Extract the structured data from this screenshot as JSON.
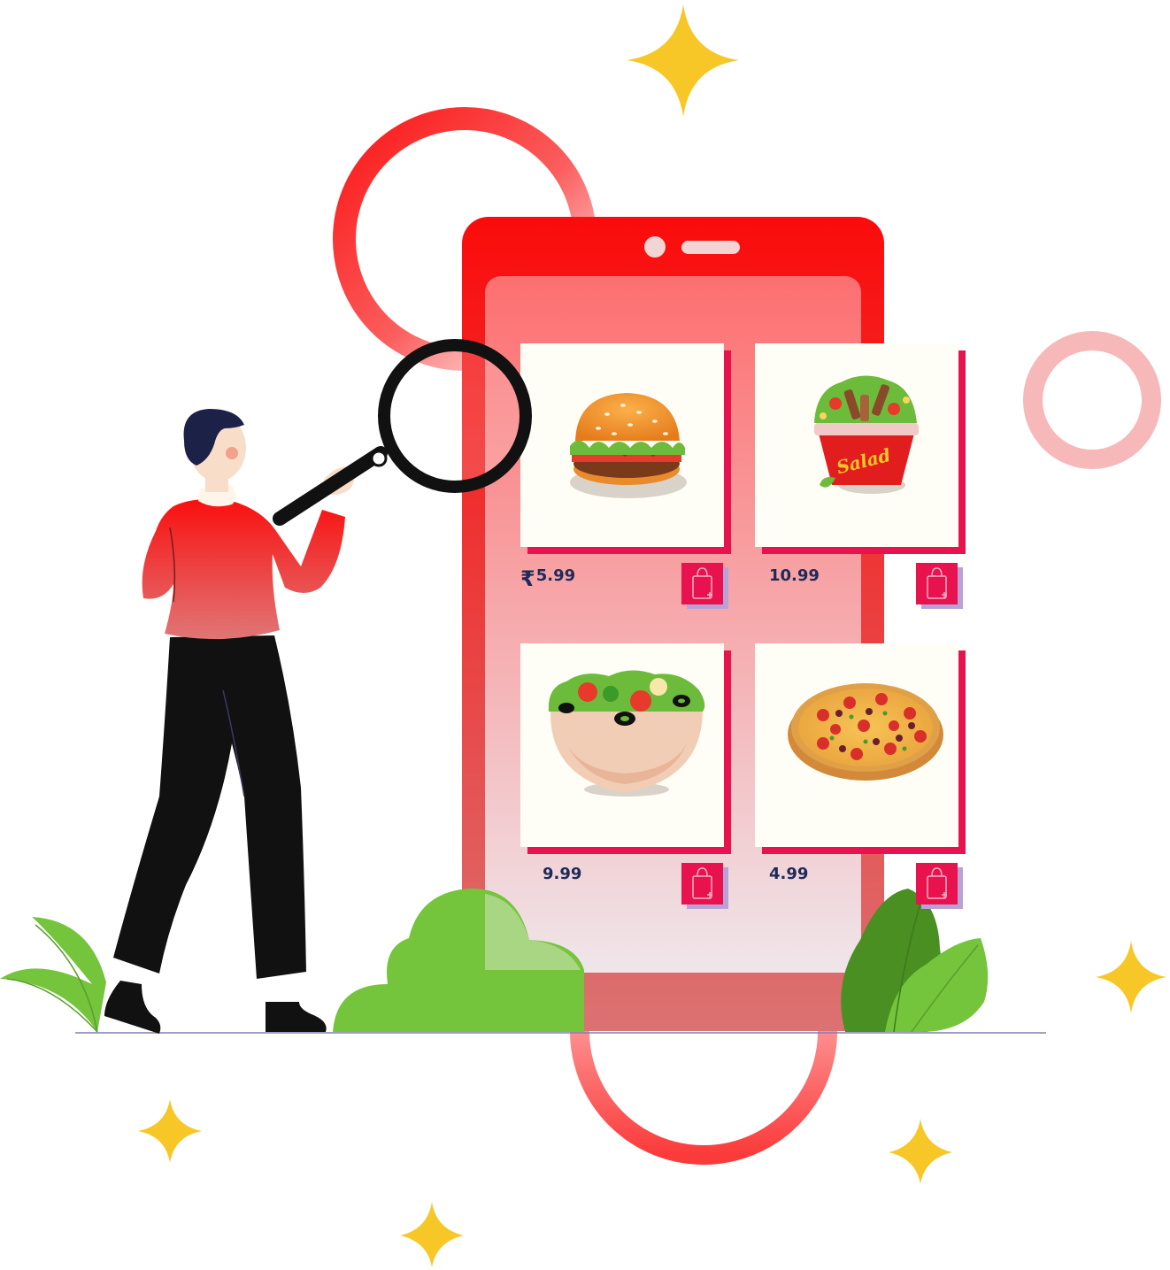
{
  "colors": {
    "phone_red": "#fb0b0b",
    "screen_top": "#fd6f70",
    "screen_bottom": "#efe6ea",
    "card_bg": "#fffef6",
    "card_shadow": "#e8124f",
    "bag_button": "#e8124f",
    "bag_shadow": "#b7a2d8",
    "price_text": "#1e2a5a",
    "sparkle": "#f7c728",
    "leaf_green": "#74c43c",
    "leaf_dark": "#4a8f22"
  },
  "menu": {
    "items": [
      {
        "name": "burger",
        "icon": "burger-icon",
        "currency": "₹",
        "price": "5.99"
      },
      {
        "name": "salad-cup",
        "icon": "salad-cup-icon",
        "currency": "",
        "price": "10.99",
        "cup_label": "Salad"
      },
      {
        "name": "salad-bowl",
        "icon": "salad-bowl-icon",
        "currency": "",
        "price": "9.99"
      },
      {
        "name": "pizza",
        "icon": "pizza-icon",
        "currency": "",
        "price": "4.99"
      }
    ]
  }
}
